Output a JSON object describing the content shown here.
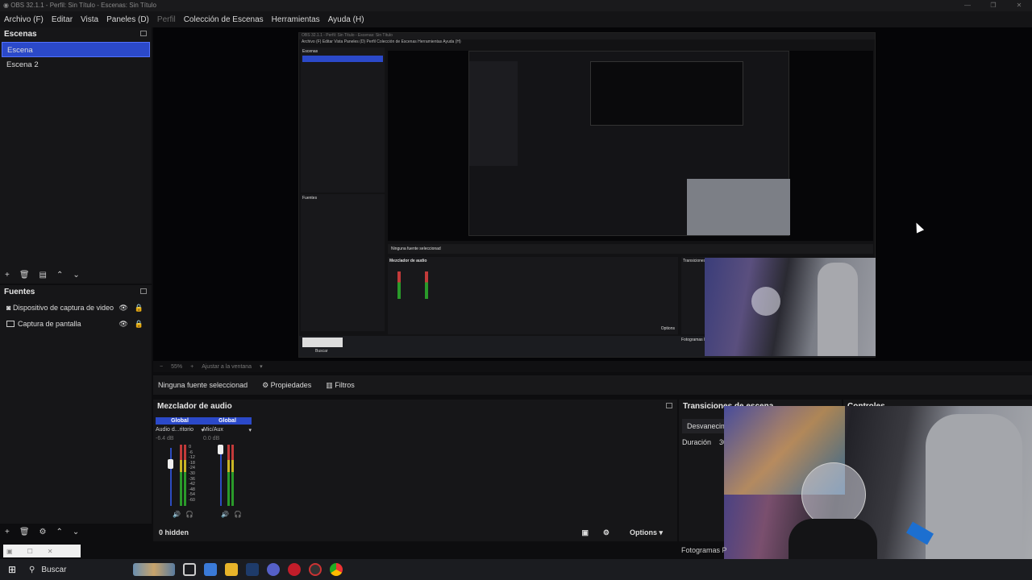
{
  "window": {
    "title": "OBS 32.1.1 - Perfil: Sin Título - Escenas: Sin Título",
    "controls": [
      "—",
      "❐",
      "✕"
    ]
  },
  "menu": [
    "Archivo (F)",
    "Editar",
    "Vista",
    "Paneles (D)",
    "Perfil",
    "Colección de Escenas",
    "Herramientas",
    "Ayuda (H)"
  ],
  "scenes": {
    "title": "Escenas",
    "items": [
      "Escena",
      "Escena 2"
    ],
    "active_index": 0
  },
  "sources": {
    "title": "Fuentes",
    "items": [
      "Dispositivo de captura de video",
      "Captura de pantalla"
    ]
  },
  "preview_bar": {
    "zoom": "55%",
    "fit": "Ajustar a la ventana"
  },
  "props": {
    "selection": "Ninguna fuente seleccionad",
    "properties": "Propiedades",
    "filters": "Filtros"
  },
  "mixer": {
    "title": "Mezclador de audio",
    "global_label": "Global",
    "channels": [
      {
        "name": "Audio d...ritorio",
        "db": "-6.4 dB",
        "level": 0.72
      },
      {
        "name": "Mic/Aux",
        "db": "0.0 dB",
        "level": 0.88
      }
    ],
    "scale": [
      "0",
      "-6",
      "-12",
      "-18",
      "-24",
      "-30",
      "-36",
      "-42",
      "-48",
      "-54",
      "-60"
    ],
    "hidden": "0 hidden",
    "options": "Options"
  },
  "transitions": {
    "title": "Transiciones de escena",
    "fade": "Desvanecim",
    "duration_label": "Duración",
    "duration_value": "30"
  },
  "controls": {
    "title": "Controles"
  },
  "stats": {
    "fps": "Fotogramas P"
  },
  "taskbar": {
    "search": "Buscar"
  },
  "nested": {
    "title": "OBS 32.1.1 - Perfil: Sin Título - Escenas: Sin Título",
    "menu": "Archivo (F)   Editar   Vista   Paneles (D)   Perfil   Colección de Escenas   Herramientas   Ayuda (H)",
    "scenes_title": "Escenas",
    "sources_title": "Fuentes",
    "selection": "Ninguna fuente seleccionad",
    "mixer_title": "Mezclador de audio",
    "transitions_title": "Transiciones de escena",
    "options": "Options",
    "fps": "Fotogramas P",
    "search": "Buscar"
  }
}
